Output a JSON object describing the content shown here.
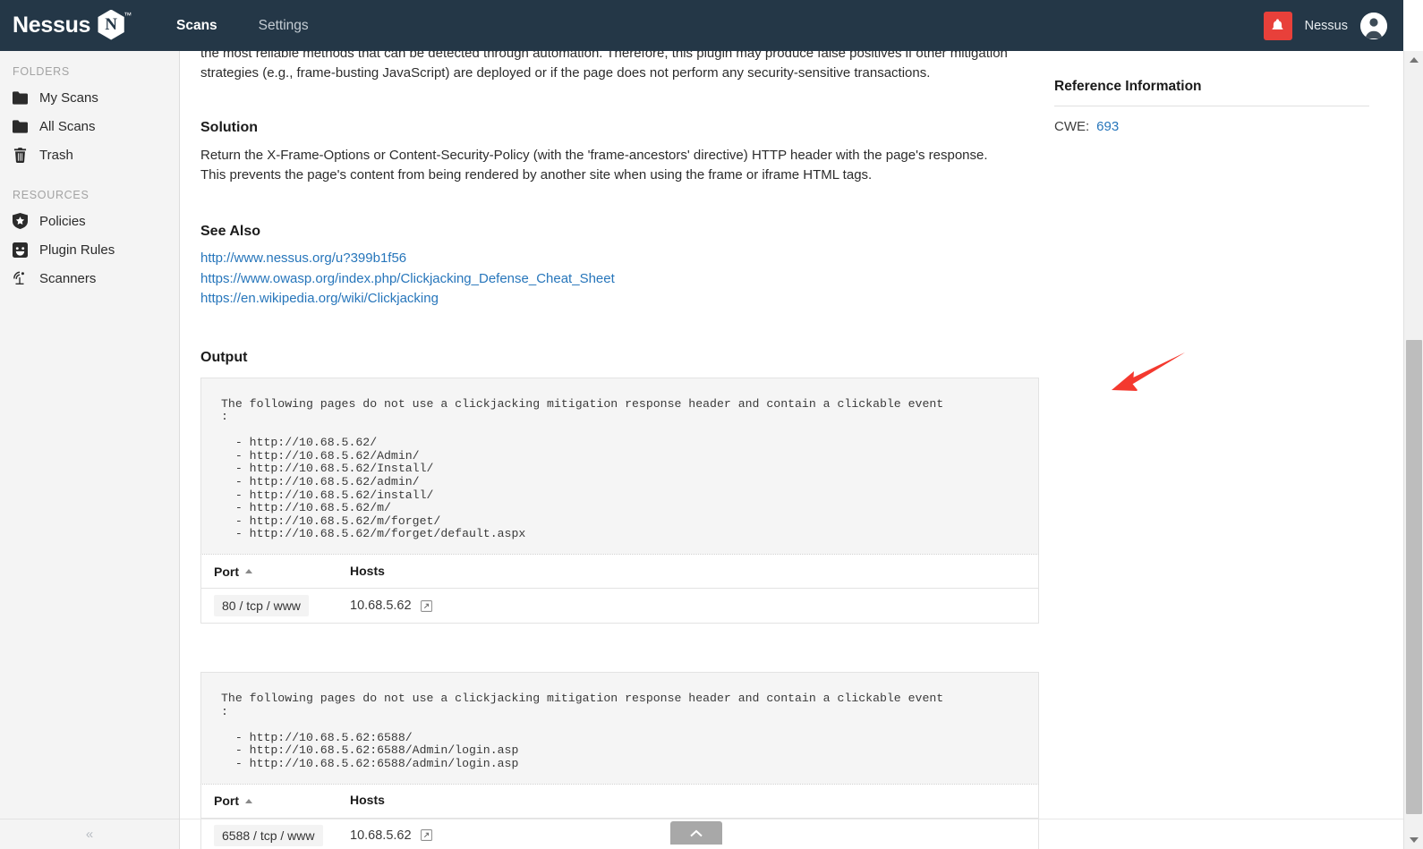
{
  "header": {
    "logo_text": "Nessus",
    "logo_letter": "N",
    "trademark": "™",
    "nav": [
      {
        "label": "Scans",
        "active": true
      },
      {
        "label": "Settings",
        "active": false
      }
    ],
    "notification_icon": "bell-icon",
    "notification_color": "#e8403a",
    "user_name": "Nessus",
    "avatar_icon": "user-avatar-icon",
    "background_color": "#243747"
  },
  "sidebar": {
    "groups": [
      {
        "label": "FOLDERS",
        "items": [
          {
            "label": "My Scans",
            "icon": "folder-icon"
          },
          {
            "label": "All Scans",
            "icon": "folder-icon"
          },
          {
            "label": "Trash",
            "icon": "trash-icon"
          }
        ]
      },
      {
        "label": "RESOURCES",
        "items": [
          {
            "label": "Policies",
            "icon": "shield-star-icon"
          },
          {
            "label": "Plugin Rules",
            "icon": "plugin-icon"
          },
          {
            "label": "Scanners",
            "icon": "scanner-radar-icon"
          }
        ]
      }
    ],
    "collapse_glyph": "«"
  },
  "main": {
    "description_clipped_line": "the most reliable methods that can be detected through automation. Therefore, this plugin may produce false positives if other mitigation",
    "description_line2": "strategies (e.g., frame-busting JavaScript) are deployed or if the page does not perform any security-sensitive transactions.",
    "solution_heading": "Solution",
    "solution_line1": "Return the X-Frame-Options or Content-Security-Policy (with the 'frame-ancestors' directive) HTTP header with the page's response.",
    "solution_line2": "This prevents the page's content from being rendered by another site when using the frame or iframe HTML tags.",
    "see_also_heading": "See Also",
    "see_also_links": [
      "http://www.nessus.org/u?399b1f56",
      "https://www.owasp.org/index.php/Clickjacking_Defense_Cheat_Sheet",
      "https://en.wikipedia.org/wiki/Clickjacking"
    ],
    "link_color": "#2776bb",
    "output_heading": "Output",
    "outputs": [
      {
        "text": "The following pages do not use a clickjacking mitigation response header and contain a clickable event\n:\n\n  - http://10.68.5.62/\n  - http://10.68.5.62/Admin/\n  - http://10.68.5.62/Install/\n  - http://10.68.5.62/admin/\n  - http://10.68.5.62/install/\n  - http://10.68.5.62/m/\n  - http://10.68.5.62/m/forget/\n  - http://10.68.5.62/m/forget/default.aspx",
        "table": {
          "columns": [
            "Port",
            "Hosts"
          ],
          "sort_column": "Port",
          "sort_direction": "asc",
          "rows": [
            {
              "port": "80 / tcp / www",
              "host": "10.68.5.62",
              "link_icon": "external-link-icon"
            }
          ]
        }
      },
      {
        "text": "The following pages do not use a clickjacking mitigation response header and contain a clickable event\n:\n\n  - http://10.68.5.62:6588/\n  - http://10.68.5.62:6588/Admin/login.asp\n  - http://10.68.5.62:6588/admin/login.asp",
        "table": {
          "columns": [
            "Port",
            "Hosts"
          ],
          "sort_column": "Port",
          "sort_direction": "asc",
          "rows": [
            {
              "port": "6588 / tcp / www",
              "host": "10.68.5.62",
              "link_icon": "external-link-icon"
            }
          ]
        }
      }
    ],
    "back_to_top_icon": "chevron-up-icon"
  },
  "reference_panel": {
    "title": "Reference Information",
    "key": "CWE:",
    "value": "693",
    "value_color": "#2776bb"
  },
  "annotation": {
    "shape": "arrow",
    "color": "#f4392f",
    "direction": "down-left"
  },
  "scrollbar": {
    "up_icon": "triangle-up-icon",
    "down_icon": "triangle-down-icon",
    "thumb": "scrollbar-thumb"
  }
}
